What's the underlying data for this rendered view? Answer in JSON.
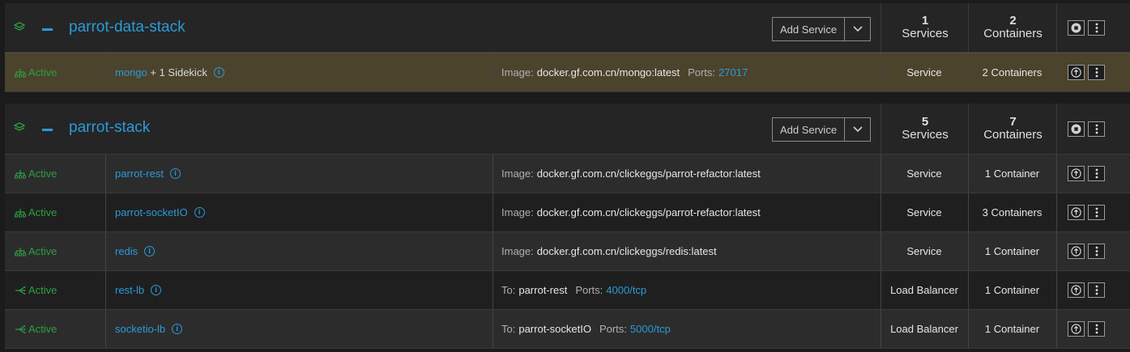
{
  "stacks": [
    {
      "name": "parrot-data-stack",
      "add_service_label": "Add Service",
      "services_count": "1",
      "services_label": "Services",
      "containers_count": "2",
      "containers_label": "Containers",
      "rows": [
        {
          "status": "Active",
          "name": "mongo",
          "extra": " + 1 Sidekick",
          "detail_label": "Image:",
          "detail_value": "docker.gf.com.cn/mongo:latest",
          "ports_label": "Ports:",
          "ports_value": "27017",
          "kind": "Service",
          "containers": "2 Containers"
        }
      ]
    },
    {
      "name": "parrot-stack",
      "add_service_label": "Add Service",
      "services_count": "5",
      "services_label": "Services",
      "containers_count": "7",
      "containers_label": "Containers",
      "rows": [
        {
          "status": "Active",
          "name": "parrot-rest",
          "extra": "",
          "detail_label": "Image:",
          "detail_value": "docker.gf.com.cn/clickeggs/parrot-refactor:latest",
          "ports_label": "",
          "ports_value": "",
          "kind": "Service",
          "containers": "1 Container"
        },
        {
          "status": "Active",
          "name": "parrot-socketIO",
          "extra": "",
          "detail_label": "Image:",
          "detail_value": "docker.gf.com.cn/clickeggs/parrot-refactor:latest",
          "ports_label": "",
          "ports_value": "",
          "kind": "Service",
          "containers": "3 Containers"
        },
        {
          "status": "Active",
          "name": "redis",
          "extra": "",
          "detail_label": "Image:",
          "detail_value": "docker.gf.com.cn/clickeggs/redis:latest",
          "ports_label": "",
          "ports_value": "",
          "kind": "Service",
          "containers": "1 Container"
        },
        {
          "status": "Active",
          "name": "rest-lb",
          "extra": "",
          "detail_label": "To:",
          "detail_value": "parrot-rest",
          "ports_label": "Ports:",
          "ports_value": "4000/tcp",
          "kind": "Load Balancer",
          "containers": "1 Container"
        },
        {
          "status": "Active",
          "name": "socketio-lb",
          "extra": "",
          "detail_label": "To:",
          "detail_value": "parrot-socketIO",
          "ports_label": "Ports:",
          "ports_value": "5000/tcp",
          "kind": "Load Balancer",
          "containers": "1 Container"
        }
      ]
    }
  ],
  "icons": {
    "stack": "layers-icon",
    "collapse": "minus-icon",
    "dropdown": "chevron-down-icon",
    "service_status": "service-nodes-icon",
    "lb_status": "load-balancer-icon",
    "info": "info-icon",
    "stack_action": "stop-circle-icon",
    "service_action": "upgrade-arrow-icon",
    "menu": "vertical-dots-icon"
  },
  "colors": {
    "accent": "#2a9bd6",
    "active": "#2e9e3f",
    "highlight_row": "#4b432c"
  }
}
